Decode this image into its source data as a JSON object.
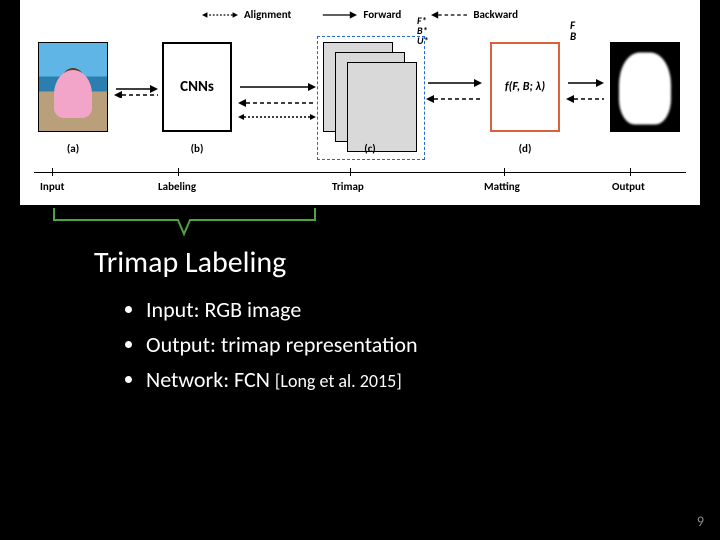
{
  "legend": {
    "alignment": "Alignment",
    "forward": "Forward",
    "backward": "Backward"
  },
  "panels": {
    "a": {
      "letter": "(a)"
    },
    "b": {
      "letter": "(b)",
      "label": "CNNs"
    },
    "c": {
      "letter": "(c)",
      "sup": {
        "F": "F*",
        "B": "B*",
        "U": "U*"
      }
    },
    "d": {
      "letter": "(d)",
      "text": "f(F, B; λ)",
      "fb": {
        "F": "F",
        "B": "B"
      }
    },
    "e": {}
  },
  "stages": {
    "input": "Input",
    "labeling": "Labeling",
    "trimap": "Trimap",
    "matting": "Matting",
    "output": "Output"
  },
  "section": {
    "title": "Trimap Labeling",
    "bullets": {
      "b1": "Input: RGB image",
      "b2": "Output: trimap representation",
      "b3_prefix": "Network: FCN ",
      "b3_cite": "[Long et al. 2015]"
    }
  },
  "page_number": "9"
}
